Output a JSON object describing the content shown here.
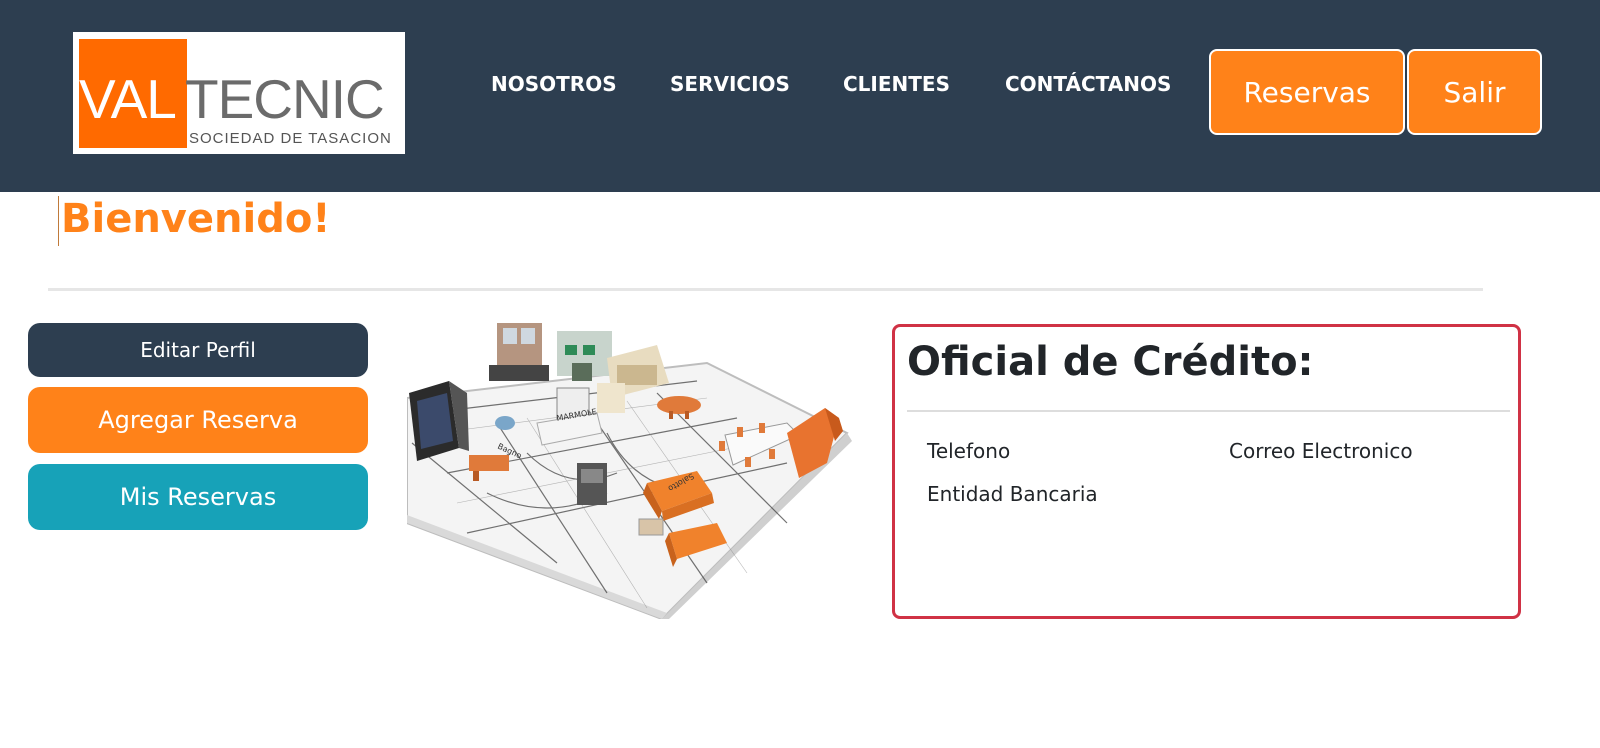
{
  "brand": {
    "logo_primary": "VAL",
    "logo_secondary": "TECNIC",
    "logo_tagline": "SOCIEDAD DE TASACION"
  },
  "nav": {
    "items": [
      "NOSOTROS",
      "SERVICIOS",
      "CLIENTES",
      "CONTÁCTANOS"
    ]
  },
  "header_buttons": {
    "reservas": "Reservas",
    "salir": "Salir"
  },
  "welcome": {
    "title": "Bienvenido!"
  },
  "sidebar": {
    "edit_profile": "Editar Perfil",
    "add_reservation": "Agregar Reserva",
    "my_reservations": "Mis Reservas"
  },
  "officer_card": {
    "title": "Oficial de Crédito:",
    "phone_label": "Telefono",
    "email_label": "Correo Electronico",
    "bank_label": "Entidad Bancaria"
  },
  "colors": {
    "header_bg": "#2d3e50",
    "accent_orange": "#ff8219",
    "teal": "#17a2b8",
    "card_border": "#d03245"
  }
}
